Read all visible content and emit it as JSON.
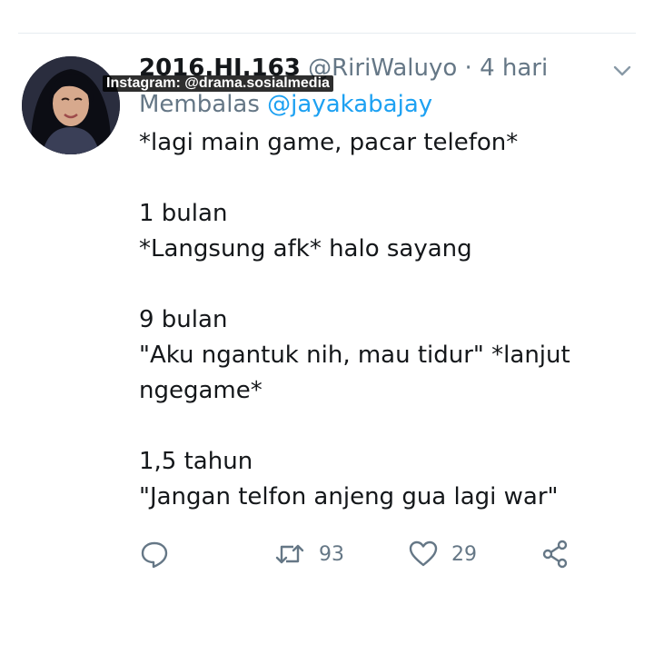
{
  "tweet": {
    "display_name": "2016.HI.163",
    "handle": "@RiriWaluyo",
    "separator": "·",
    "time": "4 hari",
    "reply_prefix": "Membalas",
    "reply_to": "@jayakabajay",
    "lines": [
      "*lagi main game, pacar telefon*",
      "",
      "1 bulan",
      "*Langsung afk* halo sayang",
      "",
      "9 bulan",
      "\"Aku ngantuk nih, mau tidur\" *lanjut",
      "ngegame*",
      "",
      "1,5 tahun",
      "\"Jangan telfon anjeng gua lagi war\""
    ]
  },
  "watermark": "Instagram: @drama.sosialmedia",
  "actions": {
    "reply_icon": "speech-bubble-icon",
    "retweet_icon": "retweet-icon",
    "retweet_count": "93",
    "like_icon": "heart-icon",
    "like_count": "29",
    "share_icon": "share-icon"
  },
  "colors": {
    "text": "#14171a",
    "secondary": "#657786",
    "link": "#1da1f2",
    "divider": "#e6ecf0"
  }
}
